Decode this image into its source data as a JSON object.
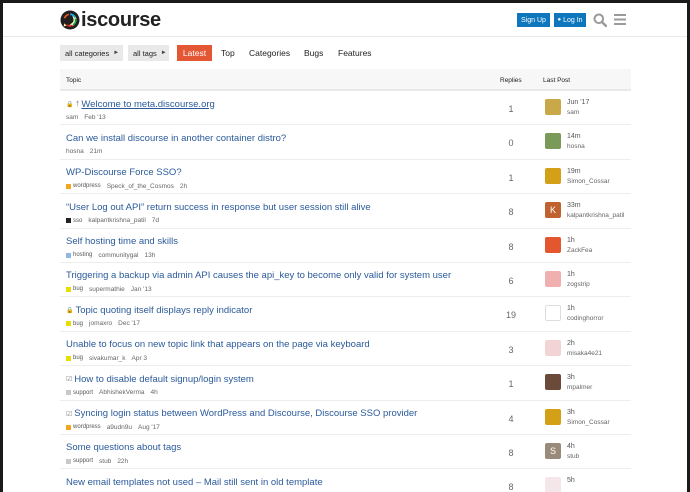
{
  "header": {
    "logo_text": "iscourse",
    "signup_label": "Sign Up",
    "login_label": "Log In",
    "login_icon": "person-icon",
    "search_icon": "search-icon",
    "menu_icon": "hamburger-icon",
    "accent": "#0e76bd"
  },
  "nav": {
    "categories_label": "all categories",
    "tags_label": "all tags",
    "tabs": [
      "Latest",
      "Top",
      "Categories",
      "Bugs",
      "Features"
    ],
    "active_tab_color": "#e45735"
  },
  "table": {
    "headers": {
      "topic": "Topic",
      "replies": "Replies",
      "last_post": "Last Post"
    },
    "rows": [
      {
        "title": "Welcome to meta.discourse.org",
        "flags": "lock-pin",
        "category": "",
        "cat_color": "",
        "poster": "sam",
        "age": "Feb '13",
        "replies": "1",
        "last_time": "Jun '17",
        "last_user": "sam",
        "avatar_color": "#c9a84a",
        "avatar_letter": ""
      },
      {
        "title": "Can we install discourse in another container distro?",
        "flags": "",
        "category": "",
        "cat_color": "",
        "poster": "hosna",
        "age": "21m",
        "replies": "0",
        "last_time": "14m",
        "last_user": "hosna",
        "avatar_color": "#7a9a5a",
        "avatar_letter": ""
      },
      {
        "title": "WP-Discourse Force SSO?",
        "flags": "",
        "category": "wordpress",
        "cat_color": "#f3a51d",
        "poster": "Speck_of_the_Cosmos",
        "age": "2h",
        "replies": "1",
        "last_time": "19m",
        "last_user": "Simon_Cossar",
        "avatar_color": "#d4a017",
        "avatar_letter": ""
      },
      {
        "title": "“User Log out API” return success in response but user session still alive",
        "flags": "",
        "category": "sso",
        "cat_color": "#222222",
        "poster": "kalpantkrishna_patil",
        "age": "7d",
        "replies": "8",
        "last_time": "33m",
        "last_user": "kalpantkrishna_patil",
        "avatar_color": "#c0622f",
        "avatar_letter": "K"
      },
      {
        "title": "Self hosting time and skills",
        "flags": "",
        "category": "hosting",
        "cat_color": "#8fb9e0",
        "poster": "communitygal",
        "age": "13h",
        "replies": "8",
        "last_time": "1h",
        "last_user": "ZackFea",
        "avatar_color": "#e4572e",
        "avatar_letter": ""
      },
      {
        "title": "Triggering a backup via admin API causes the api_key to become only valid for system user",
        "flags": "",
        "category": "bug",
        "cat_color": "#e9dd00",
        "poster": "supermathie",
        "age": "Jan '13",
        "replies": "6",
        "last_time": "1h",
        "last_user": "zogstrip",
        "avatar_color": "#f0b0b0",
        "avatar_letter": ""
      },
      {
        "title": "Topic quoting itself displays reply indicator",
        "flags": "lock",
        "category": "bug",
        "cat_color": "#e9dd00",
        "poster": "jomaxro",
        "age": "Dec '17",
        "replies": "19",
        "last_time": "1h",
        "last_user": "codinghorror",
        "avatar_color": "#ffffff",
        "avatar_letter": ""
      },
      {
        "title": "Unable to focus on new topic link that appears on the page via keyboard",
        "flags": "",
        "category": "bug",
        "cat_color": "#e9dd00",
        "poster": "sivakumar_k",
        "age": "Apr 3",
        "replies": "3",
        "last_time": "2h",
        "last_user": "misaka4e21",
        "avatar_color": "#f2d4d4",
        "avatar_letter": ""
      },
      {
        "title": "How to disable default signup/login system",
        "flags": "check",
        "category": "support",
        "cat_color": "#c8c8c8",
        "poster": "AbhishekVerma",
        "age": "4h",
        "replies": "1",
        "last_time": "3h",
        "last_user": "mpalmer",
        "avatar_color": "#6b4a3a",
        "avatar_letter": ""
      },
      {
        "title": "Syncing login status between WordPress and Discourse, Discourse SSO provider",
        "flags": "check",
        "category": "wordpress",
        "cat_color": "#f3a51d",
        "poster": "a9udn9u",
        "age": "Aug '17",
        "replies": "4",
        "last_time": "3h",
        "last_user": "Simon_Cossar",
        "avatar_color": "#d4a017",
        "avatar_letter": ""
      },
      {
        "title": "Some questions about tags",
        "flags": "",
        "category": "support",
        "cat_color": "#c8c8c8",
        "poster": "stub",
        "age": "22h",
        "replies": "8",
        "last_time": "4h",
        "last_user": "stub",
        "avatar_color": "#9a8a7a",
        "avatar_letter": "S"
      },
      {
        "title": "New email templates not used – Mail still sent in old template",
        "flags": "",
        "category": "",
        "cat_color": "",
        "poster": "",
        "age": "",
        "replies": "8",
        "last_time": "5h",
        "last_user": "",
        "avatar_color": "#f5e6ea",
        "avatar_letter": ""
      }
    ]
  }
}
